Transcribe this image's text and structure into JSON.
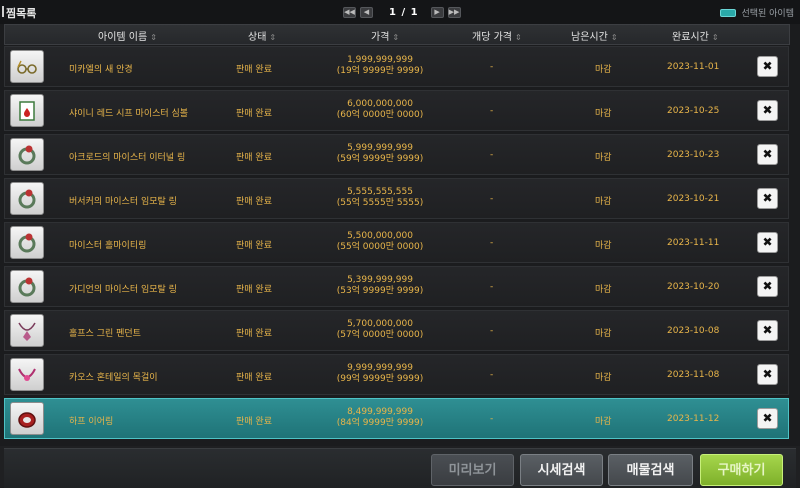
{
  "window": {
    "title": "찜목록",
    "pagination": {
      "current": "1 / 1"
    },
    "legend_label": "선택된 아이템"
  },
  "columns": {
    "item_name": "아이템 이름",
    "status": "상태",
    "price": "가격",
    "unit_price": "개당 가격",
    "remaining": "남은시간",
    "completed": "완료시간"
  },
  "items": [
    {
      "name": "미카엘의 새 안경",
      "status": "판매 완료",
      "price": "1,999,999,999",
      "price_kr": "(19억 9999만 9999)",
      "unit_price": "-",
      "remaining": "마감",
      "completed": "2023-11-01",
      "icon": "glasses-icon"
    },
    {
      "name": "샤이니 레드 시프 마이스터 심볼",
      "status": "판매 완료",
      "price": "6,000,000,000",
      "price_kr": "(60억 0000만 0000)",
      "unit_price": "-",
      "remaining": "마감",
      "completed": "2023-10-25",
      "icon": "symbol-card-icon"
    },
    {
      "name": "아크로드의 마이스터 이터널 링",
      "status": "판매 완료",
      "price": "5,999,999,999",
      "price_kr": "(59억 9999만 9999)",
      "unit_price": "-",
      "remaining": "마감",
      "completed": "2023-10-23",
      "icon": "ring-icon"
    },
    {
      "name": "버서커의 마이스터 임모탈 링",
      "status": "판매 완료",
      "price": "5,555,555,555",
      "price_kr": "(55억 5555만 5555)",
      "unit_price": "-",
      "remaining": "마감",
      "completed": "2023-10-21",
      "icon": "ring-icon"
    },
    {
      "name": "마이스터 홀마이티링",
      "status": "판매 완료",
      "price": "5,500,000,000",
      "price_kr": "(55억 0000만 0000)",
      "unit_price": "-",
      "remaining": "마감",
      "completed": "2023-11-11",
      "icon": "ring-icon"
    },
    {
      "name": "가디언의 마이스터 임모탈 링",
      "status": "판매 완료",
      "price": "5,399,999,999",
      "price_kr": "(53억 9999만 9999)",
      "unit_price": "-",
      "remaining": "마감",
      "completed": "2023-10-20",
      "icon": "ring-icon"
    },
    {
      "name": "홀프스 그린 펜던트",
      "status": "판매 완료",
      "price": "5,700,000,000",
      "price_kr": "(57억 0000만 0000)",
      "unit_price": "-",
      "remaining": "마감",
      "completed": "2023-10-08",
      "icon": "pendant-icon"
    },
    {
      "name": "카오스 혼테일의 목걸이",
      "status": "판매 완료",
      "price": "9,999,999,999",
      "price_kr": "(99억 9999만 9999)",
      "unit_price": "-",
      "remaining": "마감",
      "completed": "2023-11-08",
      "icon": "necklace-icon"
    },
    {
      "name": "하프 이어링",
      "status": "판매 완료",
      "price": "8,499,999,999",
      "price_kr": "(84억 9999만 9999)",
      "unit_price": "-",
      "remaining": "마감",
      "completed": "2023-11-12",
      "icon": "earring-icon",
      "selected": true
    }
  ],
  "buttons": {
    "preview": "미리보기",
    "price_search": "시세검색",
    "goods_search": "매물검색",
    "buy": "구매하기"
  },
  "delete_label": "✖",
  "colors": {
    "accent_teal": "#2aa9a9",
    "gold_text": "#e8b54a",
    "buy_green": "#8fc23a"
  }
}
